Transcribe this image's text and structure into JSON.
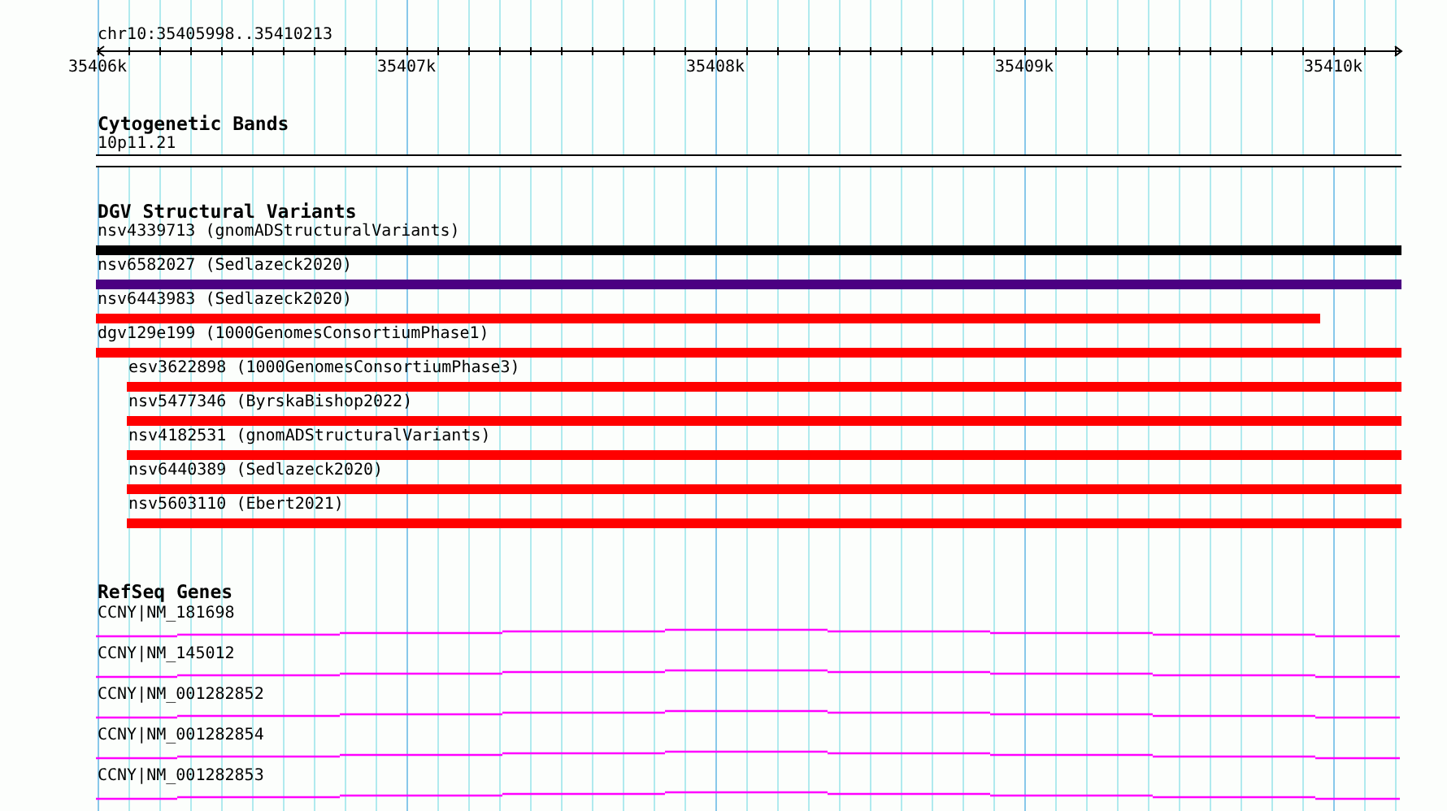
{
  "ruler": {
    "location": "chr10:35405998..35410213",
    "ticks": [
      "35406k",
      "35407k",
      "35408k",
      "35409k",
      "35410k"
    ]
  },
  "cytogenetic_bands": {
    "title": "Cytogenetic Bands",
    "band": "10p11.21"
  },
  "structural_variants": {
    "title": "DGV Structural Variants",
    "items": [
      {
        "label": "nsv4339713 (gnomADStructuralVariants)",
        "color": "#000000",
        "starts_in_view": false,
        "ends_in_view": false
      },
      {
        "label": "nsv6582027 (Sedlazeck2020)",
        "color": "#4b0082",
        "starts_in_view": false,
        "ends_in_view": false
      },
      {
        "label": "nsv6443983 (Sedlazeck2020)",
        "color": "#ff0000",
        "starts_in_view": false,
        "ends_in_view": true
      },
      {
        "label": "dgv129e199 (1000GenomesConsortiumPhase1)",
        "color": "#ff0000",
        "starts_in_view": false,
        "ends_in_view": false
      },
      {
        "label": "esv3622898 (1000GenomesConsortiumPhase3)",
        "color": "#ff0000",
        "starts_in_view": true,
        "ends_in_view": false
      },
      {
        "label": "nsv5477346 (ByrskaBishop2022)",
        "color": "#ff0000",
        "starts_in_view": true,
        "ends_in_view": false
      },
      {
        "label": "nsv4182531 (gnomADStructuralVariants)",
        "color": "#ff0000",
        "starts_in_view": true,
        "ends_in_view": false
      },
      {
        "label": "nsv6440389 (Sedlazeck2020)",
        "color": "#ff0000",
        "starts_in_view": true,
        "ends_in_view": false
      },
      {
        "label": "nsv5603110 (Ebert2021)",
        "color": "#ff0000",
        "starts_in_view": true,
        "ends_in_view": false
      }
    ]
  },
  "refseq_genes": {
    "title": "RefSeq Genes",
    "items": [
      {
        "label": "CCNY|NM_181698"
      },
      {
        "label": "CCNY|NM_145012"
      },
      {
        "label": "CCNY|NM_001282852"
      },
      {
        "label": "CCNY|NM_001282854"
      },
      {
        "label": "CCNY|NM_001282853"
      }
    ]
  }
}
